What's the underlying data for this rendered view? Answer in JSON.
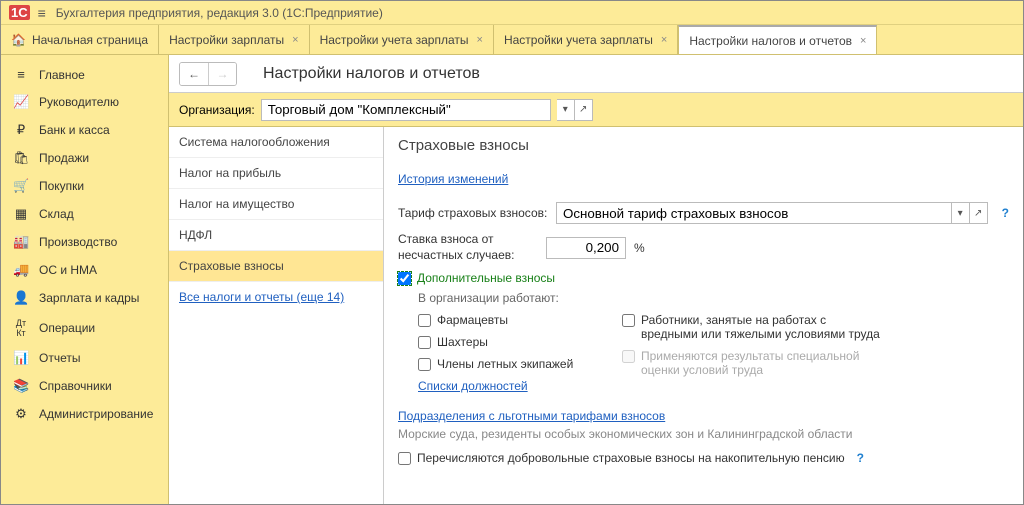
{
  "app": {
    "title": "Бухгалтерия предприятия, редакция 3.0  (1С:Предприятие)",
    "logo": "1C"
  },
  "tabs": {
    "home": "Начальная страница",
    "items": [
      {
        "label": "Настройки зарплаты"
      },
      {
        "label": "Настройки учета зарплаты"
      },
      {
        "label": "Настройки учета зарплаты"
      },
      {
        "label": "Настройки налогов и отчетов",
        "active": true
      }
    ]
  },
  "sidebar": [
    {
      "icon": "≡",
      "label": "Главное"
    },
    {
      "icon": "📈",
      "label": "Руководителю"
    },
    {
      "icon": "₽",
      "label": "Банк и касса"
    },
    {
      "icon": "🛍",
      "label": "Продажи"
    },
    {
      "icon": "🛒",
      "label": "Покупки"
    },
    {
      "icon": "▦",
      "label": "Склад"
    },
    {
      "icon": "🏭",
      "label": "Производство"
    },
    {
      "icon": "🚚",
      "label": "ОС и НМА"
    },
    {
      "icon": "👤",
      "label": "Зарплата и кадры"
    },
    {
      "icon": "ᴬᵀ",
      "label": "Операции"
    },
    {
      "icon": "📊",
      "label": "Отчеты"
    },
    {
      "icon": "📚",
      "label": "Справочники"
    },
    {
      "icon": "✿",
      "label": "Администрирование"
    }
  ],
  "page": {
    "title": "Настройки налогов и отчетов",
    "org_label": "Организация:",
    "org_value": "Торговый дом \"Комплексный\""
  },
  "settings_nav": [
    "Система налогообложения",
    "Налог на прибыль",
    "Налог на имущество",
    "НДФЛ",
    "Страховые взносы"
  ],
  "settings_nav_link": "Все налоги и отчеты (еще 14)",
  "pane": {
    "heading": "Страховые взносы",
    "history_link": "История изменений",
    "tariff_label": "Тариф страховых взносов:",
    "tariff_value": "Основной тариф страховых взносов",
    "rate_label": "Ставка взноса от несчастных случаев:",
    "rate_value": "0,200",
    "rate_unit": "%",
    "extra_label": "Дополнительные взносы",
    "work_label": "В организации работают:",
    "chk_pharm": "Фармацевты",
    "chk_miners": "Шахтеры",
    "chk_crew": "Члены летных экипажей",
    "chk_hazard": "Работники, занятые на работах с вредными или тяжелыми условиями труда",
    "chk_sout": "Применяются результаты специальной оценки условий труда",
    "jobs_link": "Списки должностей",
    "divisions_link": "Подразделения с льготными тарифами взносов",
    "divisions_hint": "Морские суда, резиденты особых экономических зон и Калининградской области",
    "pension_label": "Перечисляются добровольные страховые взносы на накопительную пенсию"
  }
}
